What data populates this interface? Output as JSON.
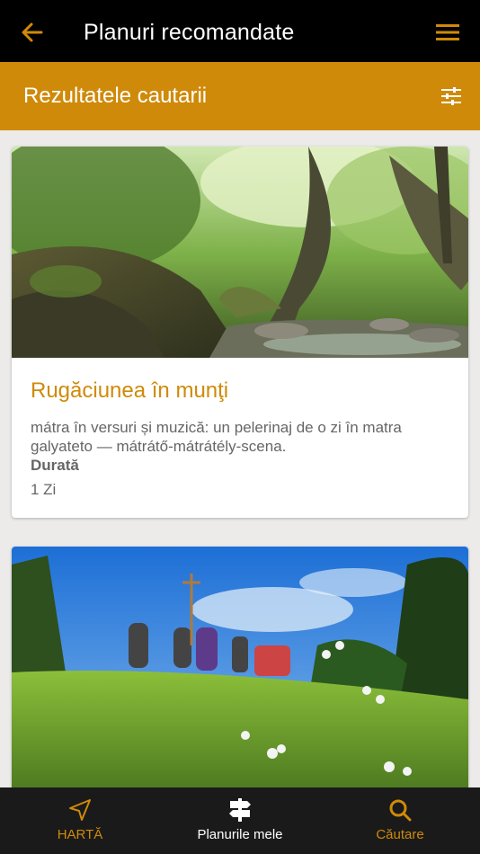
{
  "app_bar": {
    "title": "Planuri recomandate",
    "back_icon": "arrow-left-icon",
    "menu_icon": "hamburger-menu-icon"
  },
  "sub_bar": {
    "title": "Rezultatele cautarii",
    "filter_icon": "sliders-filter-icon"
  },
  "cards": [
    {
      "title": "Rugăciunea în munţi",
      "description": "mátra în versuri și muzică: un pelerinaj de o zi în matra galyateto — mátrátő-mátrátély-scena.",
      "duration_label": "Durată",
      "duration_value": "1 Zi",
      "image": "forest-stream-photo"
    },
    {
      "image": "pilgrims-meadow-photo"
    }
  ],
  "bottom_nav": [
    {
      "label": "HARTĂ",
      "icon": "navigation-arrow-icon",
      "active": false
    },
    {
      "label": "Planurile mele",
      "icon": "signpost-icon",
      "active": true
    },
    {
      "label": "Căutare",
      "icon": "search-icon",
      "active": false
    }
  ],
  "colors": {
    "accent": "#cf8a09",
    "app_bar": "#000000",
    "bottom_nav": "#1a1a1a",
    "background": "#ecebea",
    "text_muted": "#666666"
  }
}
